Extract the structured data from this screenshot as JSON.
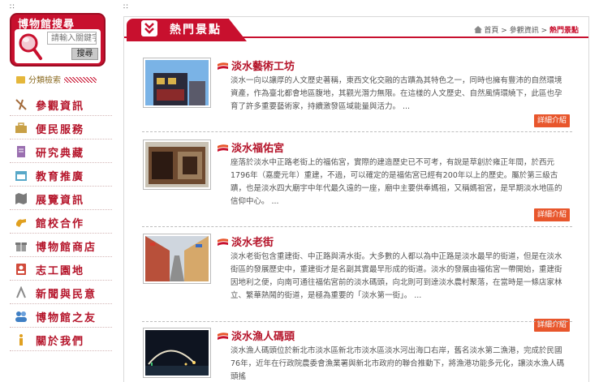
{
  "search": {
    "title": "博物館搜尋",
    "placeholder": "請輸入關鍵字",
    "button": "搜尋"
  },
  "category": {
    "label": "分類檢索"
  },
  "sidebar": {
    "items": [
      {
        "label": "參觀資訊",
        "icon": "compass-icon",
        "color": "#a36b3a"
      },
      {
        "label": "便民服務",
        "icon": "briefcase-icon",
        "color": "#c8a046"
      },
      {
        "label": "研究典藏",
        "icon": "book-icon",
        "color": "#9a6fb0"
      },
      {
        "label": "教育推廣",
        "icon": "calendar-icon",
        "color": "#58a8c8"
      },
      {
        "label": "展覽資訊",
        "icon": "map-icon",
        "color": "#7a7a7a"
      },
      {
        "label": "館校合作",
        "icon": "hand-icon",
        "color": "#e0a020"
      },
      {
        "label": "博物館商店",
        "icon": "gift-icon",
        "color": "#9a9a9a"
      },
      {
        "label": "志工園地",
        "icon": "badge-icon",
        "color": "#d14a3a"
      },
      {
        "label": "新聞與民意",
        "icon": "pen-icon",
        "color": "#8a8a8a"
      },
      {
        "label": "博物館之友",
        "icon": "people-icon",
        "color": "#3f7fc4"
      },
      {
        "label": "關於我們",
        "icon": "info-icon",
        "color": "#e0a020"
      }
    ]
  },
  "main": {
    "heading": "熱門景點",
    "breadcrumb": {
      "home": "首頁",
      "sep1": " > ",
      "section": "參觀資訊",
      "sep2": " > ",
      "current": "熱門景點"
    },
    "more_label": "詳細介紹",
    "articles": [
      {
        "title": "淡水藝術工坊",
        "body": "淡水一向以讓厚的人文歷史著稱，東西文化交融的古蹟為其特色之一，同時也擁有豐沛的自然環境資產，作為臺北都會地區腹地，其觀光潛力無限。在這樣的人文歷史、自然風情環繞下，此區也孕育了許多重要藝術家，持續激發區域能量與活力。 ..."
      },
      {
        "title": "淡水福佑宮",
        "body": "座落於淡水中正路老街上的福佑宮，實際的建造歷史已不可考，有說是草創於雍正年間，於西元1796年（嘉慶元年）重建，不過，可以確定的是福佑宮已經有200年以上的歷史。屬於第三級古蹟，也是淡水四大廟宇中年代最久遠的一座，廟中主要供奉媽祖，又稱媽祖宮，是早期淡水地區的信仰中心。 ..."
      },
      {
        "title": "淡水老街",
        "body": "淡水老街包含重建街、中正路與清水街。大多數的人都以為中正路是淡水最早的街道，但是在淡水街區的發展歷史中，重建街才是名副其實最早形成的街道。淡水的發展由福佑宮一帶開始，重建街因地利之便，向南可通往福佑宮前的淡水碼頭，向北則可到達淡水農村聚落，在當時是一條店家林立、繁華熱鬧的街道，是極為重要的「淡水第一街」。 ..."
      },
      {
        "title": "淡水漁人碼頭",
        "body": "淡水漁人碼頭位於新北市淡水區新北市淡水區淡水河出海口右岸，舊名淡水第二漁港，完成於民國76年，近年在行政院農委會漁業署與新北市政府的聯合推動下，將漁港功能多元化，讓淡水漁人碼頭搖"
      }
    ]
  }
}
